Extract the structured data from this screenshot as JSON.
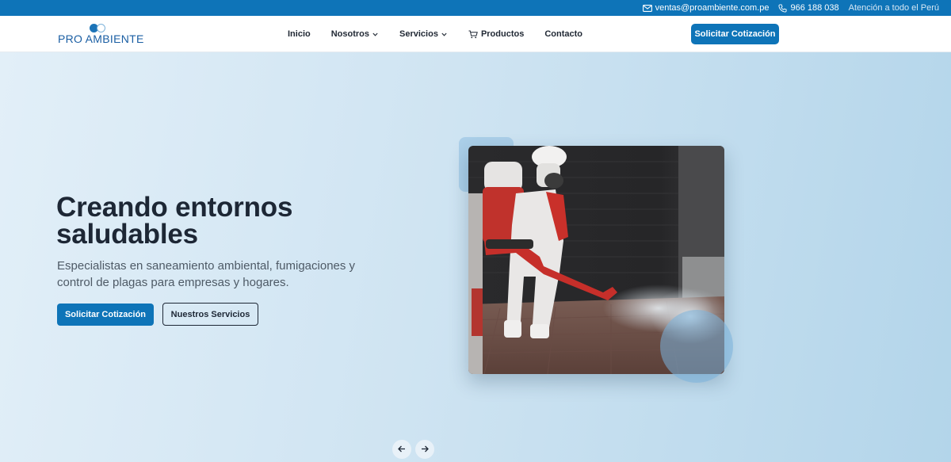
{
  "topbar": {
    "email": "ventas@proambiente.com.pe",
    "phone": "966 188 038",
    "coverage": "Atención a todo el Perú",
    "icons": {
      "email": "mail-icon",
      "phone": "phone-icon"
    }
  },
  "header": {
    "logo_text": "PRO AMBIENTE",
    "nav": [
      {
        "label": "Inicio"
      },
      {
        "label": "Nosotros",
        "icon": "chevron-down-icon"
      },
      {
        "label": "Servicios",
        "icon": "chevron-down-icon"
      },
      {
        "label": "Productos",
        "icon": "cart-icon"
      },
      {
        "label": "Contacto"
      }
    ],
    "cta_label": "Solicitar Cotización"
  },
  "hero": {
    "title": "Creando entornos saludables",
    "subtitle": "Especialistas en saneamiento ambiental, fumigaciones y control de plagas para empresas y hogares.",
    "primary_button": "Solicitar Cotización",
    "secondary_button": "Nuestros Servicios",
    "image_subject": "fumigation-worker-photo"
  },
  "carousel": {
    "prev_icon": "arrow-left-icon",
    "next_icon": "arrow-right-icon"
  },
  "colors": {
    "brand": "#0e74b8",
    "text_dark": "#1d2735",
    "text_muted": "#4e5a66",
    "hero_bg": "#cfe4f2"
  }
}
